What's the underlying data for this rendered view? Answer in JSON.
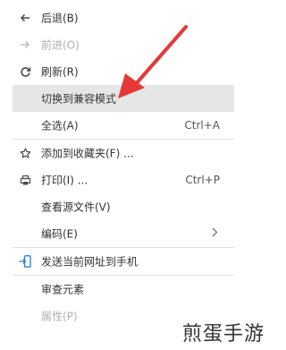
{
  "menu": {
    "back": "后退(B)",
    "forward": "前进(O)",
    "refresh": "刷新(R)",
    "compat": "切换到兼容模式",
    "select_all": "全选(A)",
    "select_all_shortcut": "Ctrl+A",
    "favorites": "添加到收藏夹(F) ...",
    "print": "打印(I) ...",
    "print_shortcut": "Ctrl+P",
    "view_source": "查看源文件(V)",
    "encoding": "编码(E)",
    "send_url": "发送当前网址到手机",
    "inspect": "审查元素",
    "properties": "属性(P)"
  },
  "watermark": "煎蛋手游",
  "colors": {
    "arrow": "#e53935",
    "icon_dark": "#4a4a4a",
    "icon_disabled": "#c0c0c0",
    "icon_accent": "#2b7cd3",
    "highlight": "#e6e6e6"
  }
}
